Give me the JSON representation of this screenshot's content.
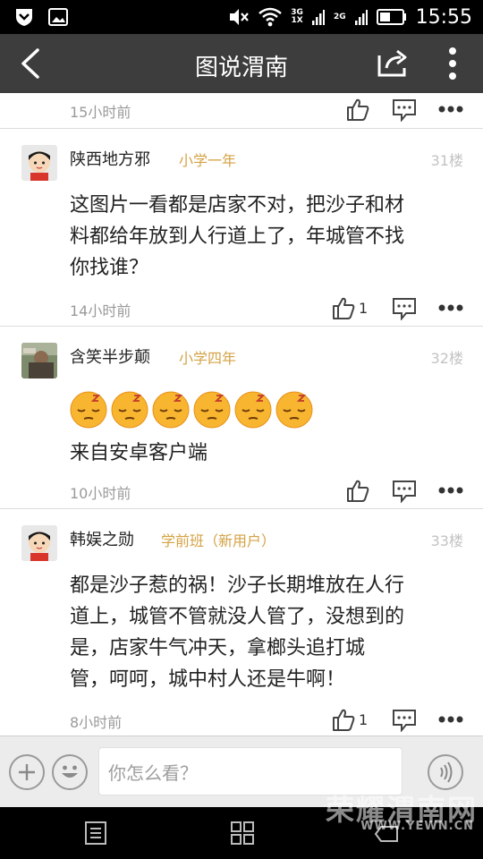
{
  "status_bar": {
    "network_top": "3G",
    "network_bottom": "1X",
    "network_2g": "2G",
    "time": "15:55"
  },
  "app_bar": {
    "title": "图说渭南",
    "icons": [
      "back-arrow-icon",
      "share-icon",
      "more-vert-icon"
    ]
  },
  "posts": [
    {
      "time": "15小时前",
      "like_count": ""
    },
    {
      "username": "陕西地方邪",
      "level": "小学一年",
      "floor": "31楼",
      "body_lines": [
        "这图片一看都是店家不对，把沙子和材",
        "料都给年放到人行道上了，年城管不找",
        "你找谁？"
      ],
      "time": "14小时前",
      "like_count": "1"
    },
    {
      "username": "含笑半步颠",
      "level": "小学四年",
      "floor": "32楼",
      "emoji_count": 6,
      "body_lines": [
        "来自安卓客户端"
      ],
      "time": "10小时前",
      "like_count": ""
    },
    {
      "username": "韩娱之勋",
      "level": "学前班（新用户）",
      "floor": "33楼",
      "body_lines": [
        "都是沙子惹的祸！沙子长期堆放在人行",
        "道上，城管不管就没人管了，没想到的",
        "是，店家牛气冲天，拿榔头追打城",
        "管，呵呵，城中村人还是牛啊！"
      ],
      "time": "8小时前",
      "like_count": "1"
    }
  ],
  "input_bar": {
    "placeholder": "你怎么看？"
  },
  "watermark": {
    "line1": "荣耀渭南网",
    "line2": "WWW.YEWN.CN"
  },
  "colors": {
    "app_bar": "#3d3d3d",
    "level_text": "#d4a244",
    "time_text": "#9a9a9a"
  }
}
